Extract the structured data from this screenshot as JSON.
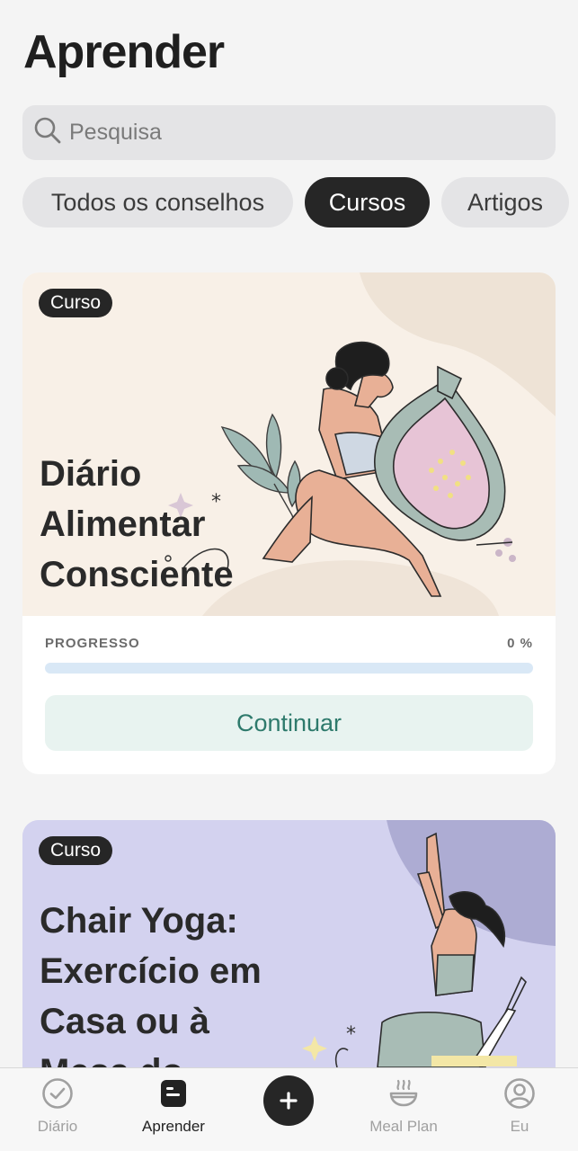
{
  "header": {
    "title": "Aprender"
  },
  "search": {
    "placeholder": "Pesquisa",
    "icon": "search-icon"
  },
  "tabs": [
    {
      "label": "Todos os conselhos",
      "active": false
    },
    {
      "label": "Cursos",
      "active": true
    },
    {
      "label": "Artigos",
      "active": false
    }
  ],
  "courses": [
    {
      "badge": "Curso",
      "title_lines": [
        "Diário",
        "Alimentar",
        "Consciente"
      ],
      "progress_label": "PROGRESSO",
      "progress_value": "0 %",
      "progress_fraction": 0,
      "button_label": "Continuar",
      "hero_color": "#f8f0e7"
    },
    {
      "badge": "Curso",
      "title_lines": [
        "Chair Yoga:",
        "Exercício em",
        "Casa ou à",
        "Mesa do"
      ],
      "hero_color": "#d3d2ef"
    }
  ],
  "bottom_nav": [
    {
      "label": "Diário",
      "icon": "check-circle-icon",
      "active": false
    },
    {
      "label": "Aprender",
      "icon": "book-icon",
      "active": true
    },
    {
      "label": "",
      "icon": "plus-icon",
      "active": false
    },
    {
      "label": "Meal Plan",
      "icon": "bowl-icon",
      "active": false
    },
    {
      "label": "Eu",
      "icon": "user-icon",
      "active": false
    }
  ],
  "colors": {
    "accent": "#2e7a6c",
    "dark": "#262626",
    "progress_track": "#d9e8f6",
    "lilac": "#d3d2ef"
  }
}
